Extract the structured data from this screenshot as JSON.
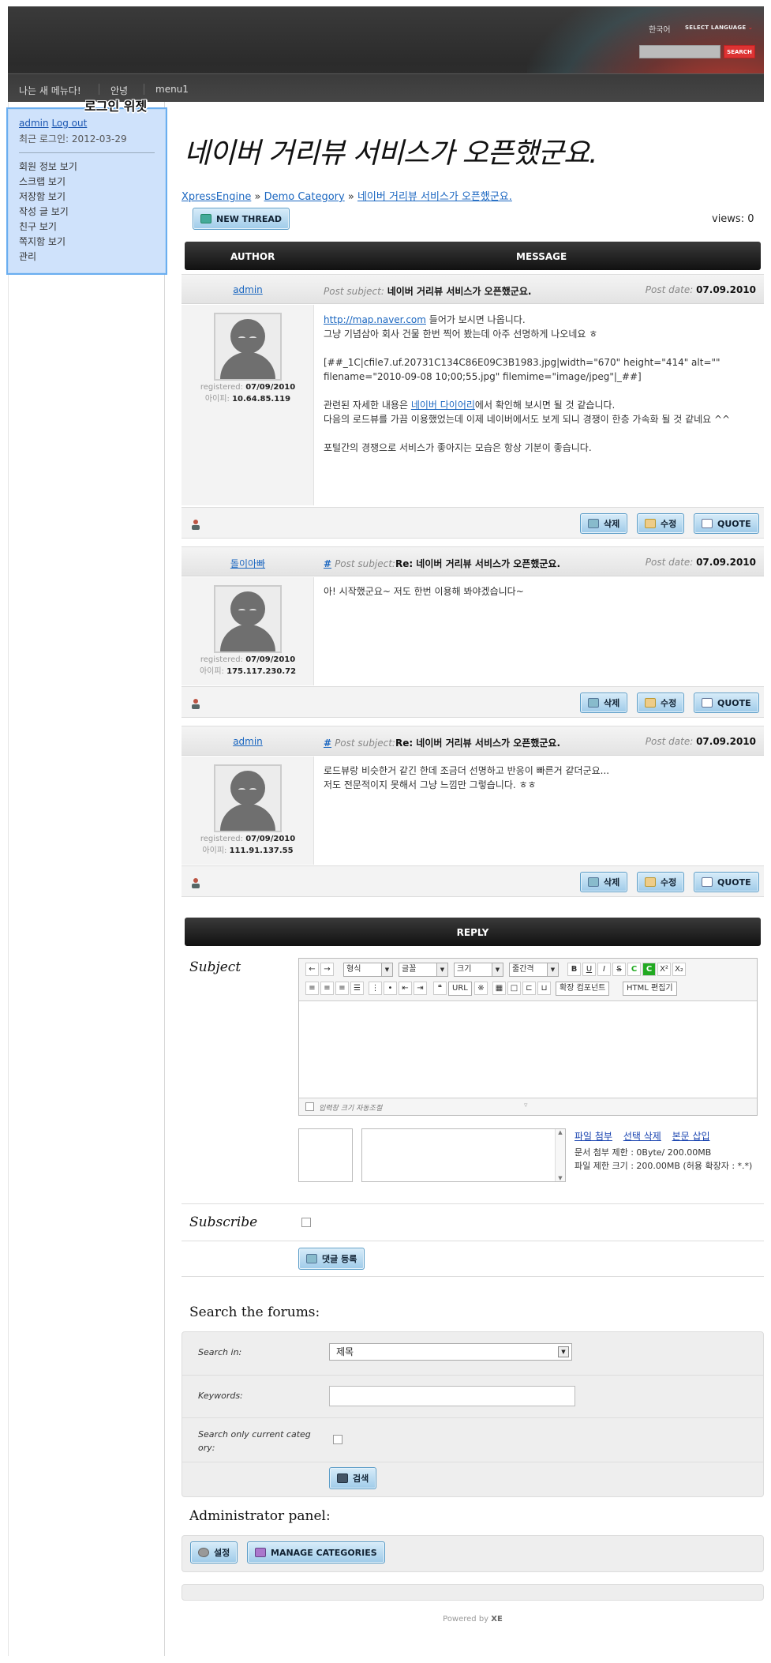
{
  "header": {
    "lang_current": "한국어",
    "lang_select": "SELECT LANGUAGE",
    "search_button": "SEARCH",
    "nav": [
      "나는 새 메뉴다!",
      "안녕",
      "menu1"
    ]
  },
  "login_widget": {
    "label": "로그인 위젯",
    "user": "admin",
    "logout": "Log out",
    "last_login": "최근 로그인: 2012-03-29",
    "menu": [
      "회원 정보 보기",
      "스크랩 보기",
      "저장함 보기",
      "작성 글 보기",
      "친구 보기",
      "쪽지함 보기",
      "관리"
    ]
  },
  "thread": {
    "title": "네이버 거리뷰 서비스가 오픈했군요.",
    "breadcrumb": [
      "XpressEngine",
      "Demo Category",
      "네이버 거리뷰 서비스가 오픈했군요."
    ],
    "breadcrumb_sep": "»",
    "new_thread": "NEW THREAD",
    "views": "views: 0",
    "col_author": "AUTHOR",
    "col_message": "MESSAGE"
  },
  "posts": [
    {
      "author": "admin",
      "hash": "",
      "subject_label": "Post subject:",
      "subject": "네이버 거리뷰 서비스가 오픈했군요.",
      "date_label": "Post date:",
      "date": "07.09.2010",
      "registered_label": "registered:",
      "registered": "07/09/2010",
      "ip_label": "아이피:",
      "ip": "10.64.85.119",
      "lines": {
        "l1_link": "http://map.naver.com",
        "l1_rest": " 들어가 보시면 나옵니다.",
        "l2": "그냥 기념삼아 회사 건물 한번 찍어 봤는데 아주 선명하게 나오네요 ㅎ",
        "l3": "[##_1C|cfile7.uf.20731C134C86E09C3B1983.jpg|width=\"670\" height=\"414\" alt=\"\" filename=\"2010-09-08 10;00;55.jpg\" filemime=\"image/jpeg\"|_##]",
        "l4_pre": "관련된 자세한 내용은 ",
        "l4_link": "네이버 다이어리",
        "l4_rest": "에서 확인해 보시면 될 것 같습니다.",
        "l5": "다음의 로드뷰를 가끔 이용했었는데 이제 네이버에서도 보게 되니 경쟁이 한층 가속화 될 것 같네요 ^^",
        "l6": "포털간의 경쟁으로 서비스가 좋아지는 모습은 항상 기분이 좋습니다."
      }
    },
    {
      "author": "돌이아빠",
      "hash": "#",
      "subject_label": "Post subject:",
      "subject": "Re: 네이버 거리뷰 서비스가 오픈했군요.",
      "date_label": "Post date:",
      "date": "07.09.2010",
      "registered_label": "registered:",
      "registered": "07/09/2010",
      "ip_label": "아이피:",
      "ip": "175.117.230.72",
      "text": "아! 시작했군요~ 저도 한번 이용해 봐야겠습니다~"
    },
    {
      "author": "admin",
      "hash": "#",
      "subject_label": "Post subject:",
      "subject": "Re: 네이버 거리뷰 서비스가 오픈했군요.",
      "date_label": "Post date:",
      "date": "07.09.2010",
      "registered_label": "registered:",
      "registered": "07/09/2010",
      "ip_label": "아이피:",
      "ip": "111.91.137.55",
      "text1": "로드뷰랑 비슷한거 같긴 한데 조금더 선명하고 반응이 빠른거 같더군요...",
      "text2": "저도 전문적이지 못해서 그냥 느낌만 그렇습니다. ㅎㅎ"
    }
  ],
  "post_buttons": {
    "delete": "삭제",
    "edit": "수정",
    "quote": "QUOTE"
  },
  "reply": {
    "header": "REPLY",
    "subject_label": "Subject",
    "toolbar": {
      "format": "형식",
      "font": "글꼴",
      "size": "크기",
      "line_height": "줄간격",
      "url": "URL",
      "ext_component": "확장 컴포넌트",
      "html_edit": "HTML 편집기"
    },
    "auto_resize": "입력창 크기 자동조절",
    "upload_links": [
      "파일 첨부",
      "선택 삭제",
      "본문 삽입"
    ],
    "upload_info1": "문서 첨부 제한 : 0Byte/ 200.00MB",
    "upload_info2": "파일 제한 크기 : 200.00MB (허용 확장자 : *.*)",
    "subscribe_label": "Subscribe",
    "submit": "댓글 등록"
  },
  "search": {
    "title": "Search the forums:",
    "in_label": "Search in:",
    "in_value": "제목",
    "keywords_label": "Keywords:",
    "current_label_1": "Search only current categ",
    "current_label_2": "ory:",
    "submit": "검색"
  },
  "admin": {
    "title": "Administrator panel:",
    "settings": "설정",
    "manage": "MANAGE CATEGORIES"
  },
  "footer": {
    "powered": "Powered by",
    "xe": "XE"
  }
}
